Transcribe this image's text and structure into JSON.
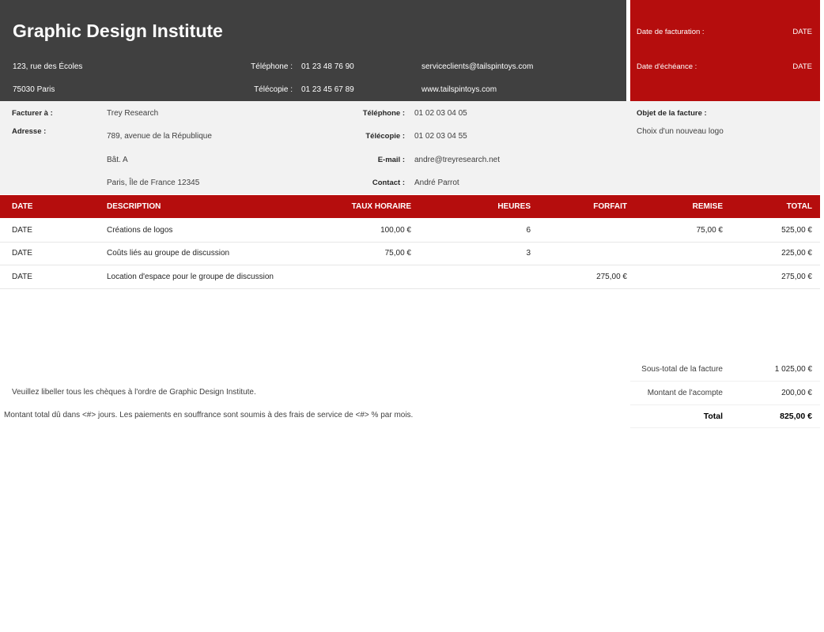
{
  "company": {
    "name": "Graphic Design Institute",
    "address1": "123, rue des Écoles",
    "address2": "75030 Paris",
    "phone_label": "Téléphone :",
    "phone": "01 23 48 76 90",
    "fax_label": "Télécopie :",
    "fax": "01 23 45 67 89",
    "email": "serviceclients@tailspintoys.com",
    "web": "www.tailspintoys.com"
  },
  "dates": {
    "invoice_label": "Date de facturation :",
    "invoice_value": "DATE",
    "due_label": "Date d'échéance :",
    "due_value": "DATE"
  },
  "client": {
    "bill_to_label": "Facturer à :",
    "bill_to": "Trey Research",
    "address_label": "Adresse :",
    "address1": "789, avenue de la République",
    "address2": "Bât. A",
    "address3": "Paris, Île de France 12345",
    "phone_label": "Téléphone :",
    "phone": "01 02 03 04 05",
    "fax_label": "Télécopie :",
    "fax": "01 02 03 04 55",
    "email_label": "E-mail :",
    "email": "andre@treyresearch.net",
    "contact_label": "Contact :",
    "contact": "André Parrot",
    "subject_label": "Objet de la facture :",
    "subject": "Choix d'un nouveau logo"
  },
  "table": {
    "headers": {
      "date": "DATE",
      "description": "DESCRIPTION",
      "rate": "TAUX HORAIRE",
      "hours": "HEURES",
      "flat": "FORFAIT",
      "discount": "REMISE",
      "total": "TOTAL"
    },
    "rows": [
      {
        "date": "DATE",
        "description": "Créations de logos",
        "rate": "100,00 €",
        "hours": "6",
        "flat": "",
        "discount": "75,00 €",
        "total": "525,00 €"
      },
      {
        "date": "DATE",
        "description": "Coûts liés au groupe de discussion",
        "rate": "75,00 €",
        "hours": "3",
        "flat": "",
        "discount": "",
        "total": "225,00 €"
      },
      {
        "date": "DATE",
        "description": "Location d'espace pour le groupe de discussion",
        "rate": "",
        "hours": "",
        "flat": "275,00 €",
        "discount": "",
        "total": "275,00 €"
      }
    ]
  },
  "summary": {
    "subtotal_label": "Sous-total de la facture",
    "subtotal": "1 025,00 €",
    "deposit_label": "Montant de l'acompte",
    "deposit": "200,00 €",
    "total_label": "Total",
    "total": "825,00 €"
  },
  "notes": {
    "checks": "Veuillez libeller tous les chèques à l'ordre de Graphic Design Institute.",
    "terms": "Montant total dû dans <#> jours. Les paiements en souffrance sont soumis à des frais de service de <#> % par mois."
  },
  "colors": {
    "dark": "#404040",
    "accent": "#b50d0d",
    "band": "#f2f2f2"
  }
}
